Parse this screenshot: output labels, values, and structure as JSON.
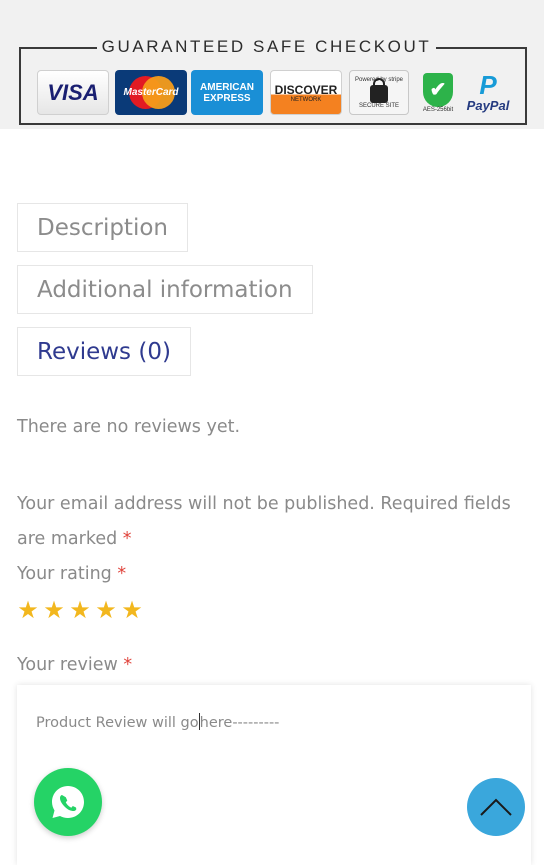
{
  "checkout": {
    "title": "GUARANTEED SAFE CHECKOUT",
    "badges": {
      "visa": "VISA",
      "mastercard": "MasterCard",
      "amex_line1": "AMERICAN",
      "amex_line2": "EXPRESS",
      "discover": "DISCOVER",
      "discover_sub": "NETWORK",
      "stripe": "Powered by stripe",
      "stripe_sub": "SECURE SITE",
      "aes": "AES-256bit",
      "paypal": "PayPal"
    }
  },
  "tabs": [
    {
      "label": "Description"
    },
    {
      "label": "Additional information"
    },
    {
      "label": "Reviews (0)"
    }
  ],
  "reviews": {
    "empty_text": "There are no reviews yet.",
    "notice_line1": "Your email address will not be published. Required fields",
    "notice_line2": "are marked",
    "required_mark": "*",
    "rating_label": "Your rating",
    "rating_stars": 5,
    "review_label": "Your review",
    "review_value_before": "Product Review will go",
    "review_value_after": "here---------"
  },
  "colors": {
    "accent": "#2f3a8f",
    "star": "#f2b71e",
    "required": "#e0443c",
    "whatsapp": "#25d366",
    "scroll_top": "#3aa7dc"
  },
  "icons": {
    "whatsapp": "whatsapp-icon",
    "scroll_top": "chevron-up-icon",
    "star": "star-icon"
  }
}
